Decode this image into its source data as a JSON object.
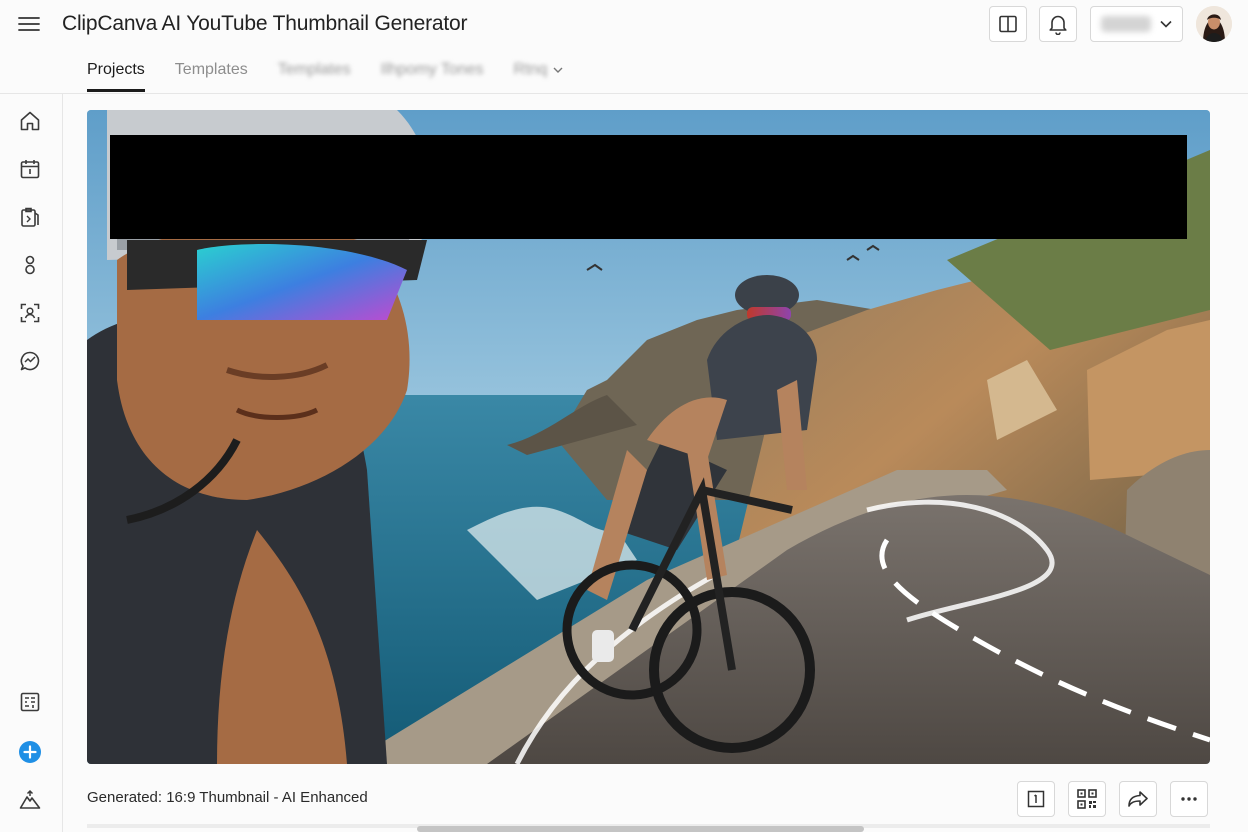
{
  "app": {
    "title": "ClipCanva AI YouTube Thumbnail Generator"
  },
  "header": {
    "menu_icon": "hamburger-icon",
    "actions": [
      {
        "name": "layout-toggle",
        "icon": "split-panel-icon"
      },
      {
        "name": "notifications",
        "icon": "bell-icon"
      }
    ],
    "account": {
      "name": "████",
      "icon": "chevron-down-icon"
    },
    "avatar_icon": "user-avatar"
  },
  "tabs": [
    {
      "label": "Projects",
      "active": true
    },
    {
      "label": "Templates",
      "active": false
    },
    {
      "label": "Templates",
      "active": false,
      "blurred": true
    },
    {
      "label": "Ilhpomy Tones",
      "active": false,
      "blurred": true
    },
    {
      "label": "Rtnq",
      "active": false,
      "blurred": true,
      "dropdown": true
    }
  ],
  "sidebar": {
    "top_icons": [
      "home-icon",
      "calendar-icon",
      "clipboard-icon",
      "people-icon",
      "scan-user-icon",
      "analytics-chat-icon"
    ],
    "bottom_icons": [
      "qr-board-icon",
      "add-circle-icon",
      "mountain-upload-icon"
    ]
  },
  "preview": {
    "image": "cyclist-coastal-road-thumbnail",
    "redacted": true
  },
  "footer": {
    "label": "Generated: 16:9 Thumbnail - AI Enhanced",
    "actions": [
      "frame-icon",
      "qr-code-icon",
      "share-icon",
      "more-icon"
    ]
  },
  "colors": {
    "accent": "#1f8fe5",
    "sky": "#7fb4d6",
    "sea": "#1e6f8f",
    "redaction": "#000000"
  }
}
